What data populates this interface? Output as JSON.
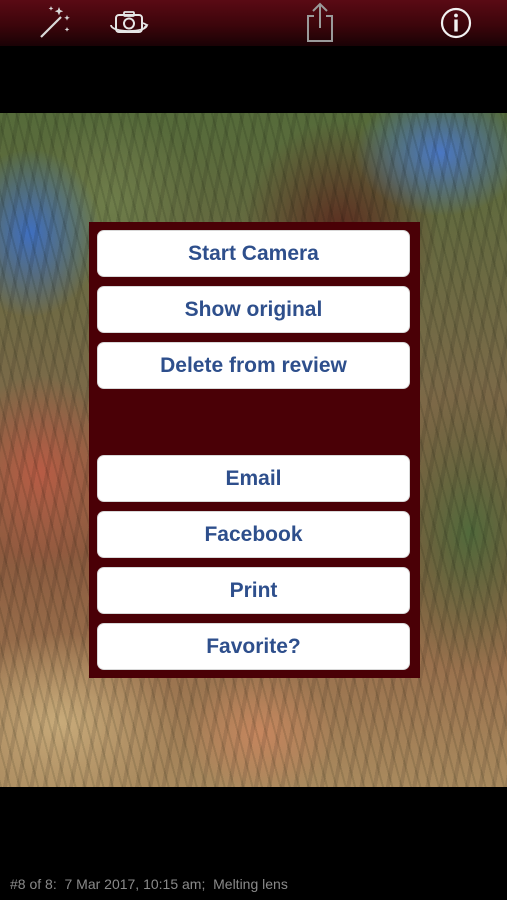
{
  "toolbar": {
    "icons": [
      "magic-wand-icon",
      "camera-rotate-icon",
      "share-icon",
      "info-icon"
    ]
  },
  "menu": {
    "top_buttons": [
      "Start Camera",
      "Show original",
      "Delete from review"
    ],
    "bottom_buttons": [
      "Email",
      "Facebook",
      "Print",
      "Favorite?"
    ]
  },
  "status": {
    "text": "#8 of 8:  7 Mar 2017, 10:15 am;  Melting lens"
  },
  "colors": {
    "menu_background": "#4a0006",
    "button_text": "#2e4f8c",
    "toolbar": "#5a0a14"
  }
}
